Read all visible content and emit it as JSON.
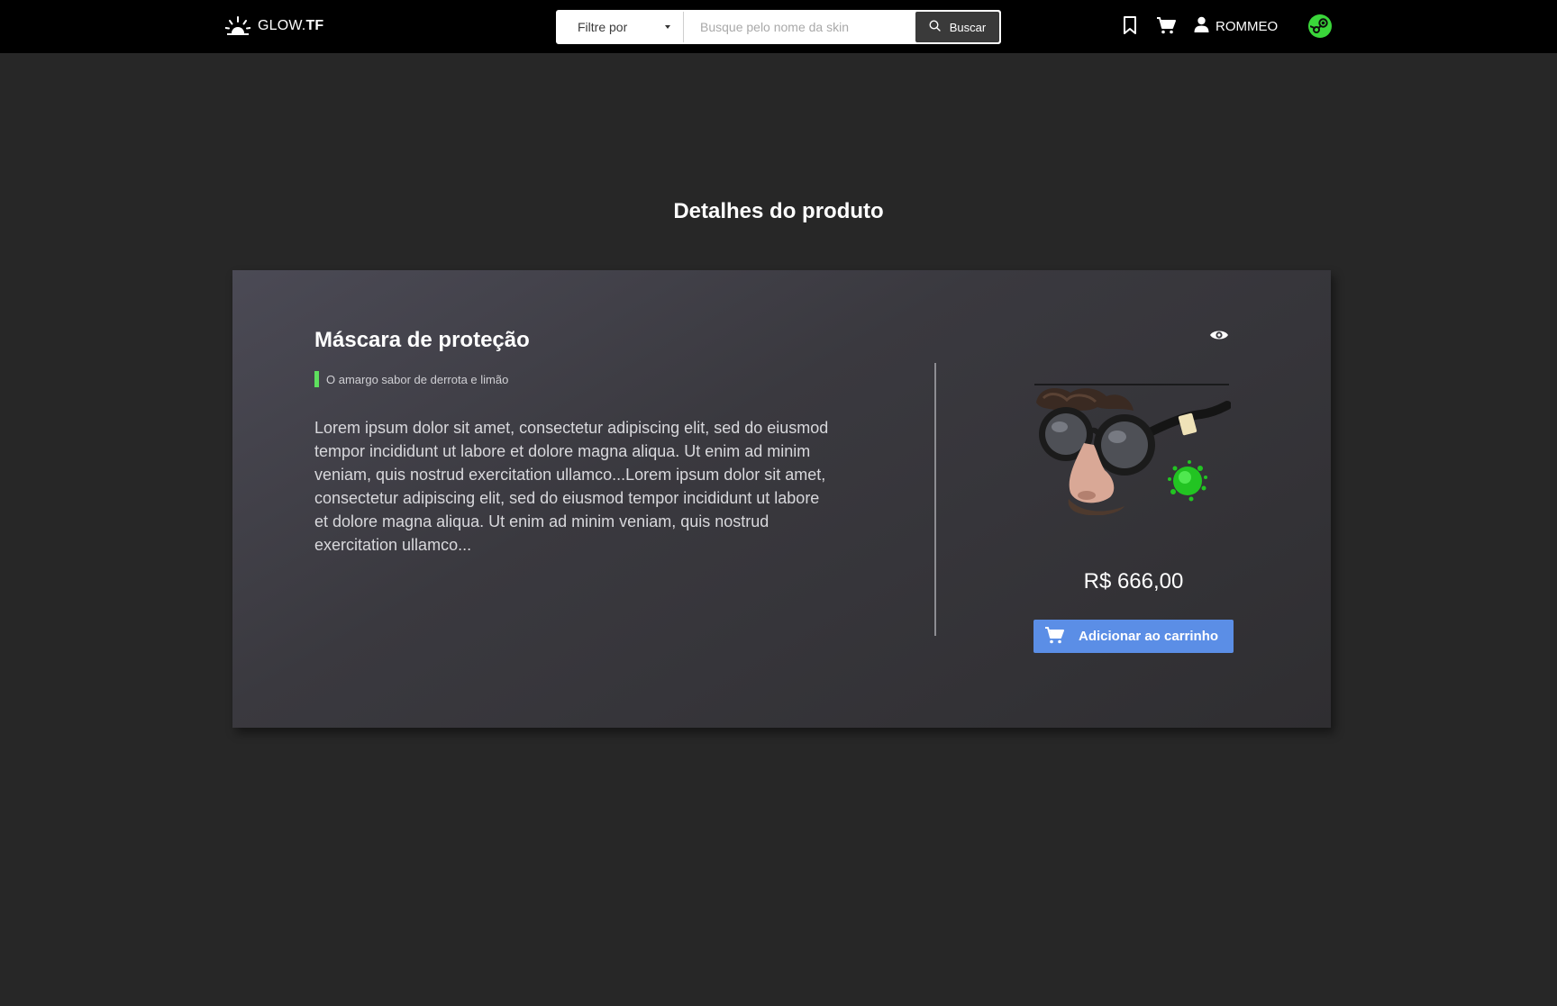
{
  "header": {
    "brand_light": "GLOW.",
    "brand_bold": "TF",
    "filter_label": "Filtre por",
    "search_placeholder": "Busque pelo nome da skin",
    "search_button": "Buscar",
    "username": "ROMMEO",
    "icons": [
      "sun-logo-icon",
      "caret-down-icon",
      "search-icon",
      "bookmark-icon",
      "cart-icon",
      "user-icon",
      "steam-icon"
    ]
  },
  "page": {
    "title": "Detalhes do produto"
  },
  "product": {
    "name": "Máscara de proteção",
    "tagline": "O amargo sabor de derrota e limão",
    "tag_color": "#5ee05e",
    "description": "Lorem ipsum dolor sit amet, consectetur adipiscing elit, sed do eiusmod  tempor incididunt ut labore et dolore magna aliqua. Ut enim ad minim  veniam, quis nostrud exercitation ullamco...Lorem ipsum dolor sit amet, consectetur adipiscing elit, sed do eiusmod  tempor incididunt ut labore et dolore magna aliqua. Ut enim ad minim veniam, quis nostrud exercitation ullamco...",
    "price": "R$ 666,00",
    "add_to_cart": "Adicionar ao carrinho",
    "button_color": "#5b8ee6"
  }
}
